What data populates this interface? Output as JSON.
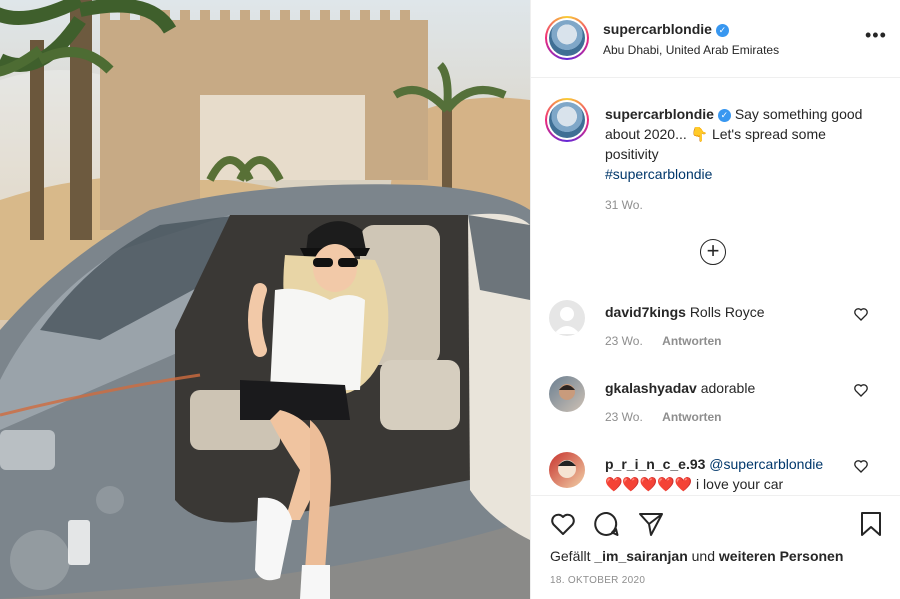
{
  "post": {
    "username": "supercarblondie",
    "location": "Abu Dhabi, United Arab Emirates",
    "more_icon": "•••"
  },
  "caption": {
    "username": "supercarblondie",
    "text": "Say something good about 2020... 👇 Let's spread some positivity",
    "hashtag": "#supercarblondie",
    "time": "31 Wo."
  },
  "load_more_icon": "+",
  "comments": [
    {
      "username": "david7kings",
      "text": "Rolls Royce",
      "mention": "",
      "time": "23 Wo.",
      "reply": "Antworten"
    },
    {
      "username": "gkalashyadav",
      "text": "adorable",
      "mention": "",
      "time": "23 Wo.",
      "reply": "Antworten"
    },
    {
      "username": "p_r_i_n_c_e.93",
      "mention": "@supercarblondie",
      "text": "❤️❤️❤️❤️❤️ i love your car",
      "time": "",
      "reply": ""
    }
  ],
  "actions": {
    "liked_prefix": "Gefällt",
    "liked_user": "_im_sairanjan",
    "liked_middle": "und",
    "liked_suffix": "weiteren Personen",
    "date": "18. Oktober 2020"
  },
  "icons": {
    "like": "heart-icon",
    "comment": "comment-icon",
    "share": "paper-plane-icon",
    "save": "bookmark-icon",
    "verified": "verified-badge-icon"
  },
  "colors": {
    "link": "#00376b",
    "verified": "#3897f0",
    "muted": "#8e8e8e"
  }
}
